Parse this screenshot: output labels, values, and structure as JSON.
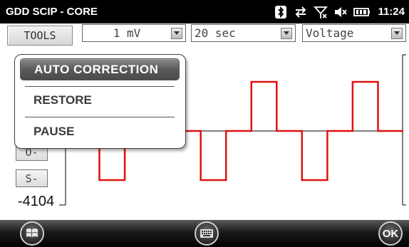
{
  "status_bar": {
    "title": "GDD SCIP - CORE",
    "time": "11:24",
    "icons": [
      "bluetooth-icon",
      "sync-icon",
      "no-signal-icon",
      "volume-muted-icon",
      "battery-icon"
    ]
  },
  "toolbar": {
    "tools_label": "TOOLS",
    "scale": "1 mV",
    "timebase": "20 sec",
    "mode": "Voltage"
  },
  "menu": {
    "items": [
      "AUTO CORRECTION",
      "RESTORE",
      "PAUSE"
    ],
    "selected": "AUTO CORRECTION"
  },
  "side_buttons": {
    "offset_label": "O-",
    "scale_label": "S-",
    "ymin_label": "-4104"
  },
  "bottom_bar": {
    "ok_label": "OK",
    "icons": [
      "windows-start-icon",
      "keyboard-icon"
    ]
  },
  "colors": {
    "trace": "#e01010",
    "status_bg": "#000000",
    "menu_highlight": "#5a5a5a"
  },
  "chart_data": {
    "type": "line",
    "series": [
      {
        "values": [
          0,
          0,
          -1,
          -1,
          0,
          0,
          1,
          1,
          0,
          0,
          -1,
          -1,
          0,
          0,
          1,
          1,
          0,
          0,
          -1,
          -1,
          0,
          0,
          1,
          1,
          0,
          0
        ]
      }
    ],
    "grid": false
  }
}
